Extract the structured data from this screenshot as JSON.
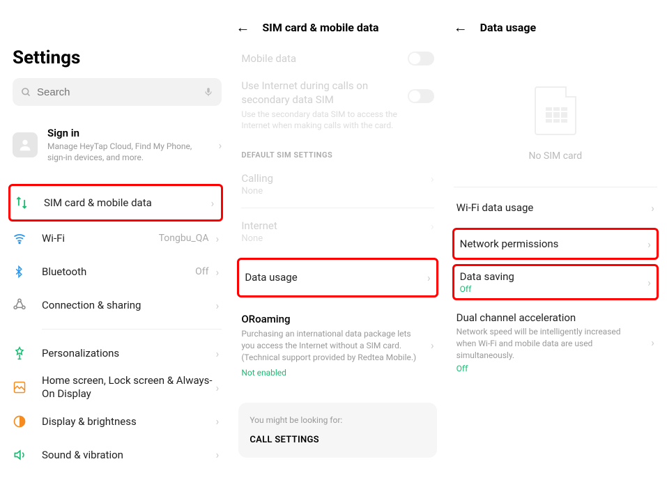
{
  "panel1": {
    "title": "Settings",
    "search_placeholder": "Search",
    "signin": {
      "title": "Sign in",
      "sub": "Manage HeyTap Cloud, Find My Phone, sign-in devices, and more."
    },
    "items": {
      "sim": {
        "label": "SIM card & mobile data"
      },
      "wifi": {
        "label": "Wi-Fi",
        "value": "Tongbu_QA"
      },
      "bluetooth": {
        "label": "Bluetooth",
        "value": "Off"
      },
      "connection": {
        "label": "Connection & sharing"
      },
      "personalizations": {
        "label": "Personalizations"
      },
      "homescreen": {
        "label": "Home screen, Lock screen & Always-On Display"
      },
      "display": {
        "label": "Display & brightness"
      },
      "sound": {
        "label": "Sound & vibration"
      }
    }
  },
  "panel2": {
    "title": "SIM card & mobile data",
    "mobile_data": "Mobile data",
    "secondary": {
      "title": "Use Internet during calls on secondary data SIM",
      "sub": "Use the secondary data SIM to access the Internet when making calls with the card."
    },
    "section_default": "DEFAULT SIM SETTINGS",
    "calling": {
      "label": "Calling",
      "value": "None"
    },
    "internet": {
      "label": "Internet",
      "value": "None"
    },
    "data_usage": "Data usage",
    "oroaming": {
      "title": "ORoaming",
      "sub": "Purchasing an international data package lets you access the Internet without a SIM card. (Technical support provided by Redtea Mobile.)",
      "status": "Not enabled"
    },
    "suggest": {
      "hint": "You might be looking for:",
      "item": "CALL SETTINGS"
    }
  },
  "panel3": {
    "title": "Data usage",
    "no_sim": "No SIM card",
    "wifi_usage": "Wi-Fi data usage",
    "network_permissions": "Network permissions",
    "data_saving": {
      "label": "Data saving",
      "status": "Off"
    },
    "dual_channel": {
      "title": "Dual channel acceleration",
      "sub": "Network speed will be intelligently increased when Wi-Fi and mobile data are used simultaneously.",
      "status": "Off"
    }
  }
}
